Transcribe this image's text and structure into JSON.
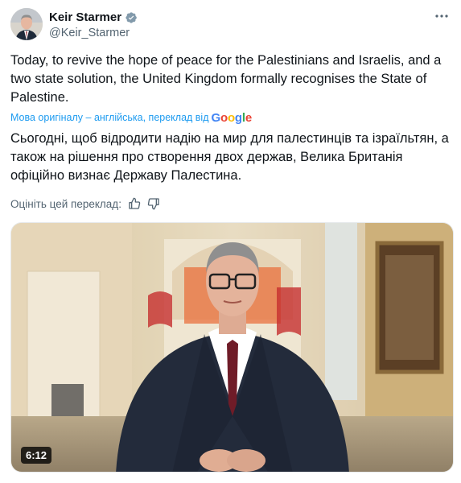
{
  "author": {
    "display_name": "Keir Starmer",
    "handle": "@Keir_Starmer",
    "verified_color": "#829aab"
  },
  "menu": {
    "more_icon": "more-horizontal-icon"
  },
  "tweet": {
    "text": "Today, to revive the hope of peace for the Palestinians and Israelis, and a two state solution, the United Kingdom formally recognises the State of Palestine."
  },
  "translation": {
    "label": "Мова оригіналу – англійська, переклад від",
    "provider": {
      "g1": "G",
      "o1": "o",
      "o2": "o",
      "g2": "g",
      "l": "l",
      "e": "e"
    },
    "text": "Сьогодні, щоб відродити надію на мир для палестинців та ізраїльтян, а також на рішення про створення двох держав, Велика Британія офіційно визнає Державу Палестина.",
    "rate_label": "Оцініть цей переклад:"
  },
  "media": {
    "duration": "6:12",
    "accent": "#1d9bf0"
  }
}
